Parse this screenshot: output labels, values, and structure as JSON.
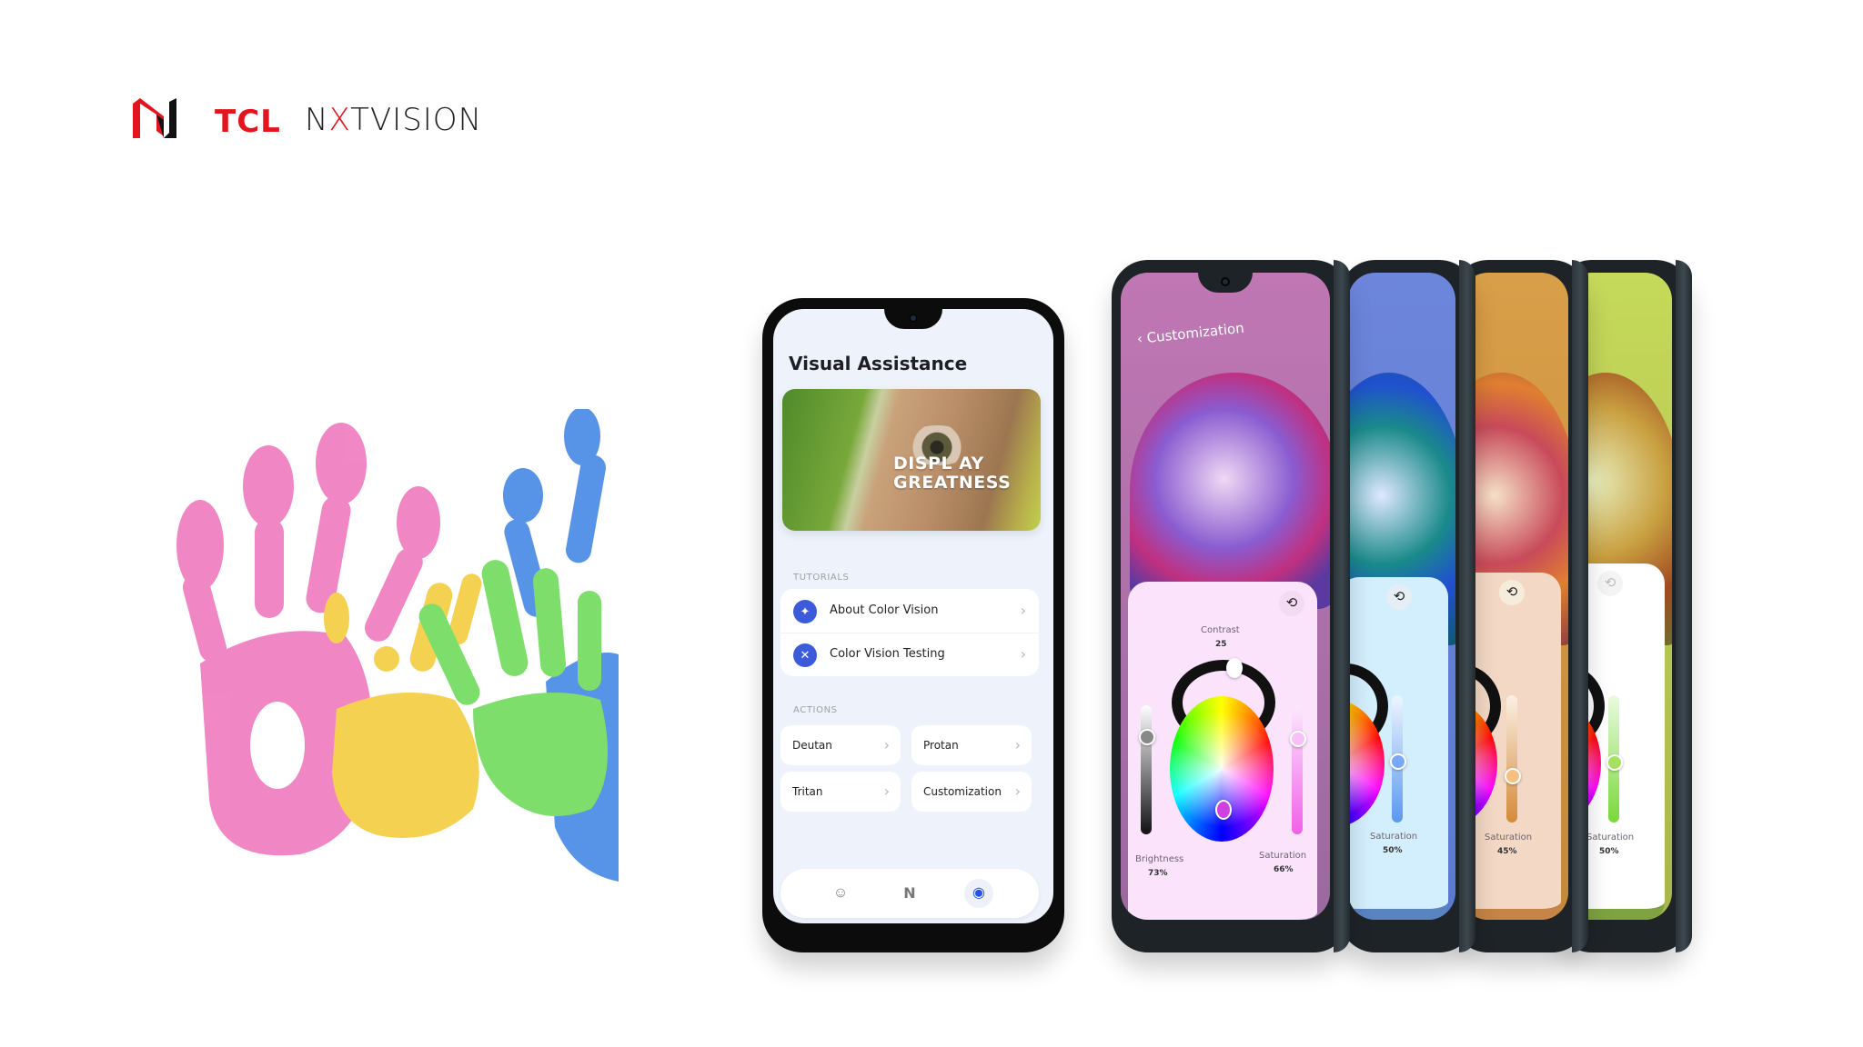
{
  "brand": {
    "name_tcl": "TCL",
    "name_nxt_1": "N",
    "name_nxt_x": "X",
    "name_nxt_2": "TVISION",
    "accent_red": "#e3141d",
    "logo_icon": "nxtvision-n-logo-icon"
  },
  "main_phone": {
    "title": "Visual Assistance",
    "hero_text_line1": "DISPL  AY",
    "hero_text_line2": "GREATNESS",
    "tutorials_label": "TUTORIALS",
    "tutorials": [
      {
        "label": "About Color Vision",
        "icon": "lightbulb-icon"
      },
      {
        "label": "Color Vision Testing",
        "icon": "tools-icon"
      }
    ],
    "actions_label": "ACTIONS",
    "actions": [
      {
        "label": "Deutan"
      },
      {
        "label": "Protan"
      },
      {
        "label": "Tritan"
      },
      {
        "label": "Customization"
      }
    ],
    "chevron": "›",
    "nav": [
      {
        "icon": "face-profile-icon",
        "glyph": "☺",
        "active": false
      },
      {
        "icon": "nxtvision-n-icon",
        "glyph": "N",
        "active": true
      },
      {
        "icon": "eye-icon",
        "glyph": "◉",
        "active": true
      }
    ],
    "accent_blue": "#3b5bdb"
  },
  "customization_phones": [
    {
      "title": "Customization",
      "back_glyph": "‹",
      "contrast_label": "Contrast",
      "contrast_value": "25",
      "brightness_label": "Brightness",
      "brightness_value": "73%",
      "saturation_label": "Saturation",
      "saturation_value": "66%",
      "reset_glyph": "⟲",
      "theme_bg": "#b06ea8",
      "panel_bg": "#fbe3fb",
      "panel_border": "#8a6690"
    },
    {
      "saturation_label": "Saturation",
      "saturation_value": "50%",
      "reset_glyph": "⟲",
      "theme_bg": "#6f87d8",
      "panel_bg": "#d3eefd",
      "panel_border": "#5a84c0"
    },
    {
      "saturation_label": "Saturation",
      "saturation_value": "45%",
      "reset_glyph": "⟲",
      "theme_bg": "#d6a04e",
      "panel_bg": "#f3d9c5",
      "panel_border": "#c68446"
    },
    {
      "saturation_label": "Saturation",
      "saturation_value": "50%",
      "reset_glyph": "⟲",
      "theme_bg": "#c3d45c",
      "panel_bg": "#ffffff",
      "panel_border": "#7fa340"
    }
  ]
}
